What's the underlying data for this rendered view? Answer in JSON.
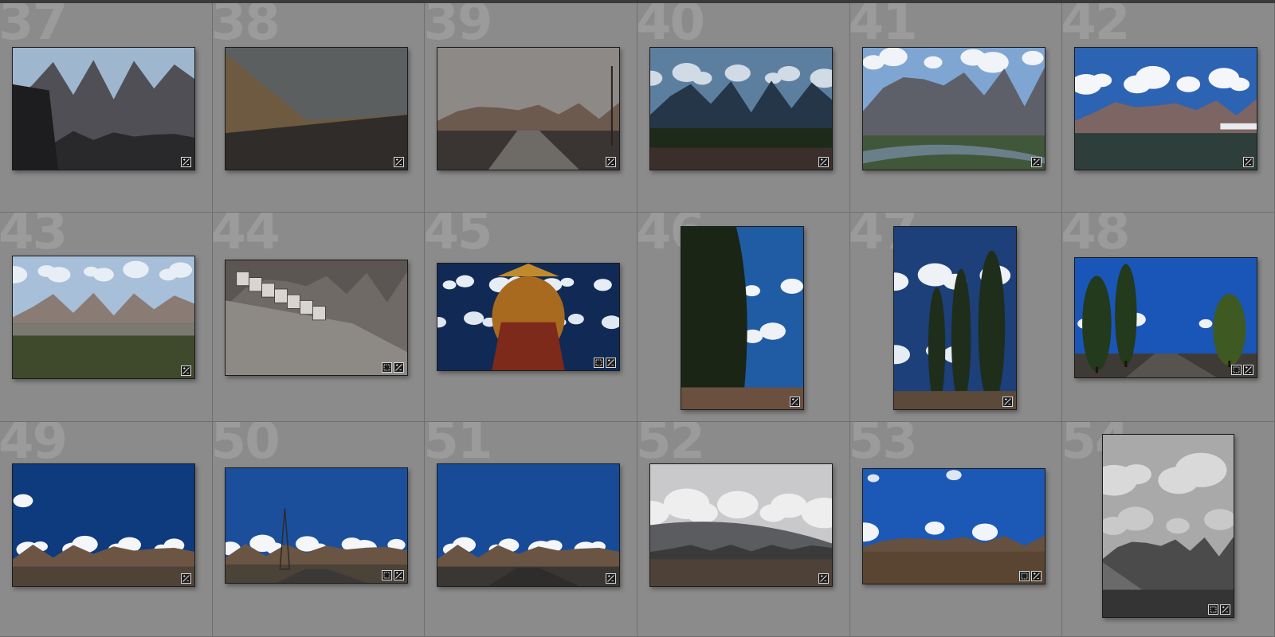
{
  "photos": [
    {
      "number": "37",
      "badges": [
        "edit"
      ],
      "scene": "mountain-valley",
      "colors": {
        "sky": "#9fb6cf",
        "mid": "#4f4f55",
        "ground": "#29282a"
      }
    },
    {
      "number": "38",
      "badges": [
        "edit"
      ],
      "scene": "storm-slope",
      "colors": {
        "sky": "#5c5f60",
        "mid": "#6e5a40",
        "ground": "#2f2c29"
      }
    },
    {
      "number": "39",
      "badges": [
        "edit"
      ],
      "scene": "foggy-road",
      "colors": {
        "sky": "#8d8987",
        "mid": "#6d5a4e",
        "ground": "#3a3533"
      }
    },
    {
      "number": "40",
      "badges": [
        "edit"
      ],
      "scene": "dusk-mountains",
      "colors": {
        "sky": "#5c7fa0",
        "mid": "#243648",
        "ground": "#1d2a1a"
      }
    },
    {
      "number": "41",
      "badges": [
        "edit"
      ],
      "scene": "river-valley",
      "colors": {
        "sky": "#7fa6d2",
        "mid": "#5e6069",
        "ground": "#41573a"
      }
    },
    {
      "number": "42",
      "badges": [
        "edit"
      ],
      "scene": "cloud-lake",
      "colors": {
        "sky": "#2d63b3",
        "mid": "#7d6563",
        "ground": "#2e3e3a"
      }
    },
    {
      "number": "43",
      "badges": [
        "edit"
      ],
      "scene": "wide-valley",
      "colors": {
        "sky": "#a7bfd8",
        "mid": "#8b7b75",
        "ground": "#3f4a2c"
      }
    },
    {
      "number": "44",
      "badges": [
        "crop",
        "edit"
      ],
      "scene": "monastery-cliff",
      "colors": {
        "sky": "#5b5553",
        "mid": "#8d8a86",
        "ground": "#4e4b49"
      }
    },
    {
      "number": "45",
      "badges": [
        "crop",
        "edit"
      ],
      "scene": "statue-sky",
      "colors": {
        "sky": "#102a55",
        "mid": "#a86a1f",
        "ground": "#7d2a1a"
      }
    },
    {
      "number": "46",
      "badges": [
        "edit"
      ],
      "scene": "tree-sky-portrait",
      "colors": {
        "sky": "#1f5ca4",
        "mid": "#1a2516",
        "ground": "#6b5040"
      }
    },
    {
      "number": "47",
      "badges": [
        "edit"
      ],
      "scene": "poplars-portrait",
      "colors": {
        "sky": "#1d3f7a",
        "mid": "#1e2e1a",
        "ground": "#5b4a3a"
      }
    },
    {
      "number": "48",
      "badges": [
        "crop",
        "edit"
      ],
      "scene": "poplar-road",
      "colors": {
        "sky": "#1a55b8",
        "mid": "#233a1c",
        "ground": "#3e3b36"
      }
    },
    {
      "number": "49",
      "badges": [
        "edit"
      ],
      "scene": "desert-clouds",
      "colors": {
        "sky": "#0e3a7e",
        "mid": "#6d5544",
        "ground": "#4f4337"
      }
    },
    {
      "number": "50",
      "badges": [
        "crop",
        "edit"
      ],
      "scene": "pylon-clouds",
      "colors": {
        "sky": "#1b4f9c",
        "mid": "#6a5443",
        "ground": "#4b4238"
      }
    },
    {
      "number": "51",
      "badges": [
        "edit"
      ],
      "scene": "road-clouds",
      "colors": {
        "sky": "#174b97",
        "mid": "#6a5443",
        "ground": "#3a3633"
      }
    },
    {
      "number": "52",
      "badges": [
        "edit"
      ],
      "scene": "overcast-plain",
      "colors": {
        "sky": "#c9c9cb",
        "mid": "#3b3a3a",
        "ground": "#4e4137"
      }
    },
    {
      "number": "53",
      "badges": [
        "crop",
        "edit"
      ],
      "scene": "blue-sky-plain",
      "colors": {
        "sky": "#1c58b5",
        "mid": "#66503f",
        "ground": "#5a4533"
      }
    },
    {
      "number": "54",
      "badges": [
        "crop",
        "edit"
      ],
      "scene": "bw-clouds-portrait",
      "colors": {
        "sky": "#a9a9a9",
        "mid": "#4b4b4b",
        "ground": "#343434"
      }
    }
  ]
}
